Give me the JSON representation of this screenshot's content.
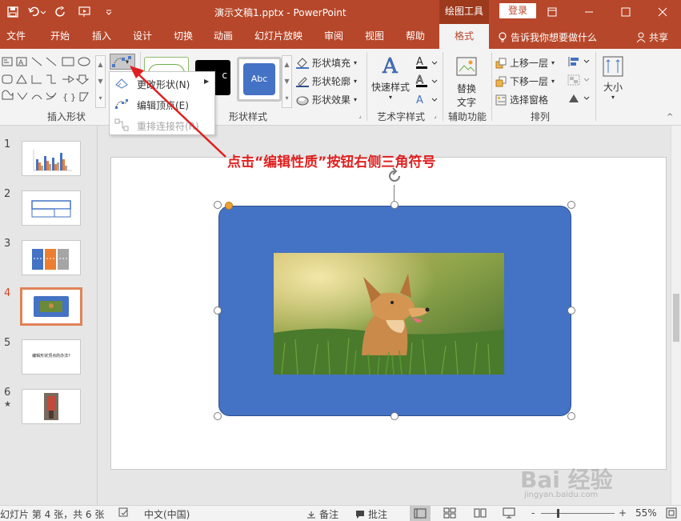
{
  "titlebar": {
    "title": "演示文稿1.pptx  -  PowerPoint",
    "context_tab": "绘图工具",
    "login": "登录"
  },
  "tabs": [
    "文件",
    "开始",
    "插入",
    "设计",
    "切换",
    "动画",
    "幻灯片放映",
    "审阅",
    "视图",
    "帮助",
    "格式"
  ],
  "active_tab": "格式",
  "tell_me": "告诉我你想要做什么",
  "share": "共享",
  "ribbon": {
    "groups": {
      "insert_shapes": "插入形状",
      "shape_styles": "形状样式",
      "wordart_styles": "艺术字样式",
      "accessibility": "辅助功能",
      "arrange": "排列"
    },
    "style_thumb_text": "Abc",
    "shape_fill": "形状填充",
    "shape_outline": "形状轮廓",
    "shape_effects": "形状效果",
    "quick_styles": "快速样式",
    "alt_text_line1": "替换",
    "alt_text_line2": "文字",
    "bring_forward": "上移一层",
    "send_backward": "下移一层",
    "selection_pane": "选择窗格",
    "size": "大小"
  },
  "menu": {
    "items": [
      {
        "label": "更改形状(N)",
        "enabled": true
      },
      {
        "label": "编辑顶点(E)",
        "enabled": true
      },
      {
        "label": "重排连接符(R)",
        "enabled": false
      }
    ]
  },
  "annotation": "点击“编辑性质”按钮右侧三角符号",
  "slides": [
    {
      "number": "1",
      "active": false,
      "starred": false
    },
    {
      "number": "2",
      "active": false,
      "starred": false
    },
    {
      "number": "3",
      "active": false,
      "starred": false
    },
    {
      "number": "4",
      "active": true,
      "starred": false
    },
    {
      "number": "5",
      "active": false,
      "starred": false,
      "text": "编辑形状顶点的办法?"
    },
    {
      "number": "6",
      "active": false,
      "starred": true
    }
  ],
  "status": {
    "slide_info": "幻灯片 第 4 张，共 6 张",
    "language": "中文(中国)",
    "notes": "备注",
    "comments": "批注",
    "zoom_minus": "-",
    "zoom_plus": "+",
    "zoom": "55%"
  },
  "watermark": {
    "brand": "Bai 经验",
    "url": "jingyan.baidu.com"
  },
  "colors": {
    "accent": "#b7472a",
    "shape_fill": "#4472c4",
    "annotation": "#e02020"
  }
}
